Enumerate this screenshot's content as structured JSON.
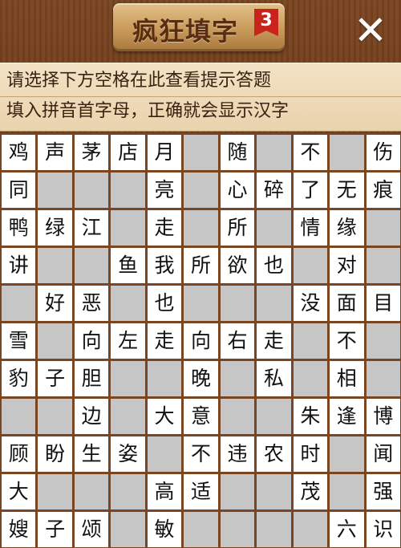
{
  "header": {
    "title": "疯狂填字",
    "level": "3",
    "close_label": "✕"
  },
  "hint": {
    "line1": "请选择下方空格在此查看提示答题",
    "line2": "填入拼音首字母，正确就会显示汉字"
  },
  "grid": {
    "rows": [
      [
        "鸡",
        "声",
        "茅",
        "店",
        "月",
        "#",
        "随",
        "#",
        "不",
        "#",
        "伤"
      ],
      [
        "同",
        "#",
        "#",
        "#",
        "亮",
        "#",
        "心",
        "碎",
        "了",
        "无",
        "痕"
      ],
      [
        "鸭",
        "绿",
        "江",
        "#",
        "走",
        "#",
        "所",
        "#",
        "情",
        "缘",
        "#"
      ],
      [
        "讲",
        "#",
        "#",
        "鱼",
        "我",
        "所",
        "欲",
        "也",
        "#",
        "对",
        "#"
      ],
      [
        "#",
        "好",
        "恶",
        "#",
        "也",
        "#",
        "#",
        "#",
        "没",
        "面",
        "目"
      ],
      [
        "雪",
        "#",
        "向",
        "左",
        "走",
        "向",
        "右",
        "走",
        "#",
        "不",
        "#"
      ],
      [
        "豹",
        "子",
        "胆",
        "#",
        "#",
        "晚",
        "#",
        "私",
        "#",
        "相",
        "#"
      ],
      [
        "#",
        "#",
        "边",
        "#",
        "大",
        "意",
        "#",
        "#",
        "朱",
        "逢",
        "博"
      ],
      [
        "顾",
        "盼",
        "生",
        "姿",
        "#",
        "不",
        "违",
        "农",
        "时",
        "#",
        "闻"
      ],
      [
        "大",
        "#",
        "#",
        "#",
        "高",
        "适",
        "#",
        "#",
        "茂",
        "#",
        "强"
      ],
      [
        "嫂",
        "子",
        "颂",
        "#",
        "敏",
        "#",
        "#",
        "#",
        "#",
        "六",
        "识"
      ]
    ]
  },
  "colors": {
    "wood": "#6a3817",
    "cell_white": "#ffffff",
    "cell_gray": "#c6c6c6",
    "badge_red": "#c8241c"
  }
}
